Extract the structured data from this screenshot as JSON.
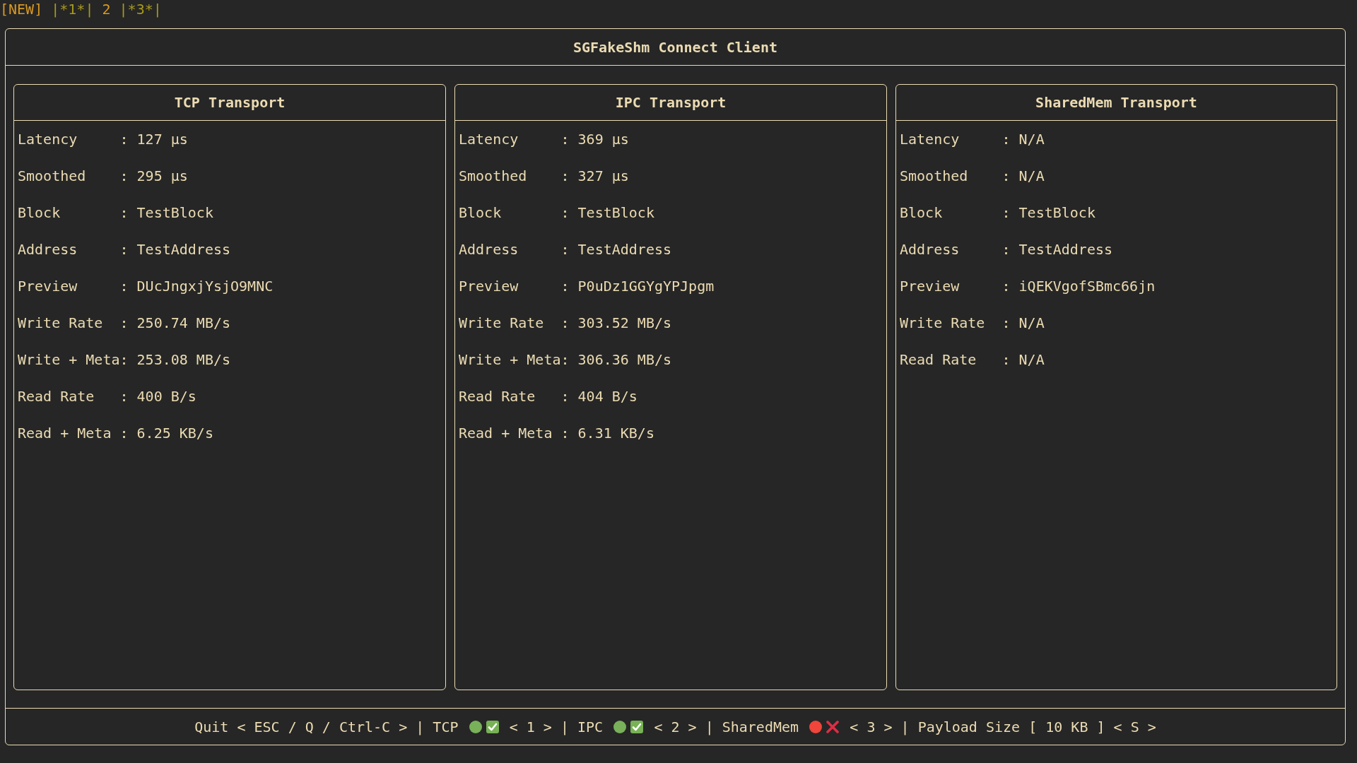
{
  "tabs": [
    {
      "label": "[NEW]",
      "kind": "plain"
    },
    {
      "label": "|*1*|",
      "kind": "marked"
    },
    {
      "label": "2",
      "kind": "plain"
    },
    {
      "label": "|*3*|",
      "kind": "marked"
    }
  ],
  "window": {
    "title": "SGFakeShm Connect Client"
  },
  "panels": [
    {
      "title": "TCP Transport",
      "rows": [
        {
          "label": "Latency",
          "separator": ":",
          "value": "127 µs"
        },
        {
          "label": "Smoothed",
          "separator": ":",
          "value": "295 µs"
        },
        {
          "label": "Block",
          "separator": ":",
          "value": "TestBlock"
        },
        {
          "label": "Address",
          "separator": ":",
          "value": "TestAddress"
        },
        {
          "label": "Preview",
          "separator": ":",
          "value": "DUcJngxjYsjO9MNC"
        },
        {
          "label": "Write Rate",
          "separator": ":",
          "value": "250.74 MB/s"
        },
        {
          "label": "Write + Meta",
          "separator": ":",
          "value": "253.08 MB/s"
        },
        {
          "label": "Read Rate",
          "separator": ":",
          "value": "400 B/s"
        },
        {
          "label": "Read + Meta",
          "separator": ":",
          "value": "6.25 KB/s"
        }
      ]
    },
    {
      "title": "IPC Transport",
      "rows": [
        {
          "label": "Latency",
          "separator": ":",
          "value": "369 µs"
        },
        {
          "label": "Smoothed",
          "separator": ":",
          "value": "327 µs"
        },
        {
          "label": "Block",
          "separator": ":",
          "value": "TestBlock"
        },
        {
          "label": "Address",
          "separator": ":",
          "value": "TestAddress"
        },
        {
          "label": "Preview",
          "separator": ":",
          "value": "P0uDz1GGYgYPJpgm"
        },
        {
          "label": "Write Rate",
          "separator": ":",
          "value": "303.52 MB/s"
        },
        {
          "label": "Write + Meta",
          "separator": ":",
          "value": "306.36 MB/s"
        },
        {
          "label": "Read Rate",
          "separator": ":",
          "value": "404 B/s"
        },
        {
          "label": "Read + Meta",
          "separator": ":",
          "value": "6.31 KB/s"
        }
      ]
    },
    {
      "title": "SharedMem Transport",
      "rows": [
        {
          "label": "Latency",
          "separator": ":",
          "value": "N/A"
        },
        {
          "label": "Smoothed",
          "separator": ":",
          "value": "N/A"
        },
        {
          "label": "Block",
          "separator": ":",
          "value": "TestBlock"
        },
        {
          "label": "Address",
          "separator": ":",
          "value": "TestAddress"
        },
        {
          "label": "Preview",
          "separator": ":",
          "value": "iQEKVgofSBmc66jn"
        },
        {
          "label": "Write Rate",
          "separator": ":",
          "value": "N/A"
        },
        {
          "label": "Read Rate",
          "separator": ":",
          "value": "N/A"
        }
      ]
    }
  ],
  "status_bar": {
    "segments": [
      {
        "kind": "hint",
        "label": "Quit",
        "keys": "< ESC / Q / Ctrl-C >"
      },
      {
        "kind": "separator",
        "text": "|"
      },
      {
        "kind": "transport",
        "name": "TCP",
        "connected": true,
        "keys": "< 1 >"
      },
      {
        "kind": "separator",
        "text": "|"
      },
      {
        "kind": "transport",
        "name": "IPC",
        "connected": true,
        "keys": "< 2 >"
      },
      {
        "kind": "separator",
        "text": "|"
      },
      {
        "kind": "transport",
        "name": "SharedMem",
        "connected": false,
        "keys": "< 3 >"
      },
      {
        "kind": "separator",
        "text": "|"
      },
      {
        "kind": "setting",
        "label": "Payload Size",
        "value": "[ 10 KB ]",
        "keys": "< S >"
      }
    ]
  }
}
